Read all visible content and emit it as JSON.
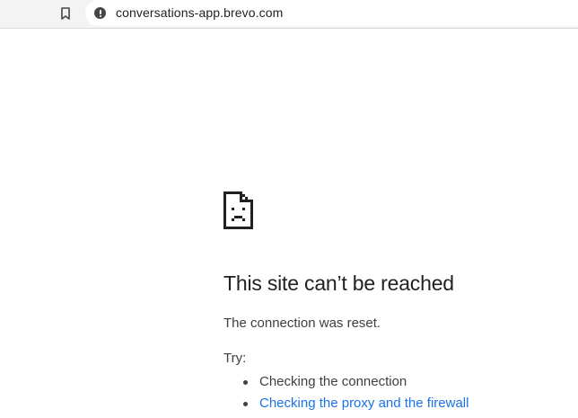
{
  "browser": {
    "url": "conversations-app.brevo.com",
    "bookmark_icon": "bookmark-icon",
    "site_info_icon": "info-icon"
  },
  "error_page": {
    "icon": "sad-document-icon",
    "title": "This site can’t be reached",
    "message": "The connection was reset.",
    "try_label": "Try:",
    "suggestions": [
      {
        "text": "Checking the connection",
        "is_link": false
      },
      {
        "text": "Checking the proxy and the firewall",
        "is_link": true
      }
    ],
    "colors": {
      "title": "#202124",
      "body": "#3c4043",
      "link": "#1a73e8"
    }
  }
}
